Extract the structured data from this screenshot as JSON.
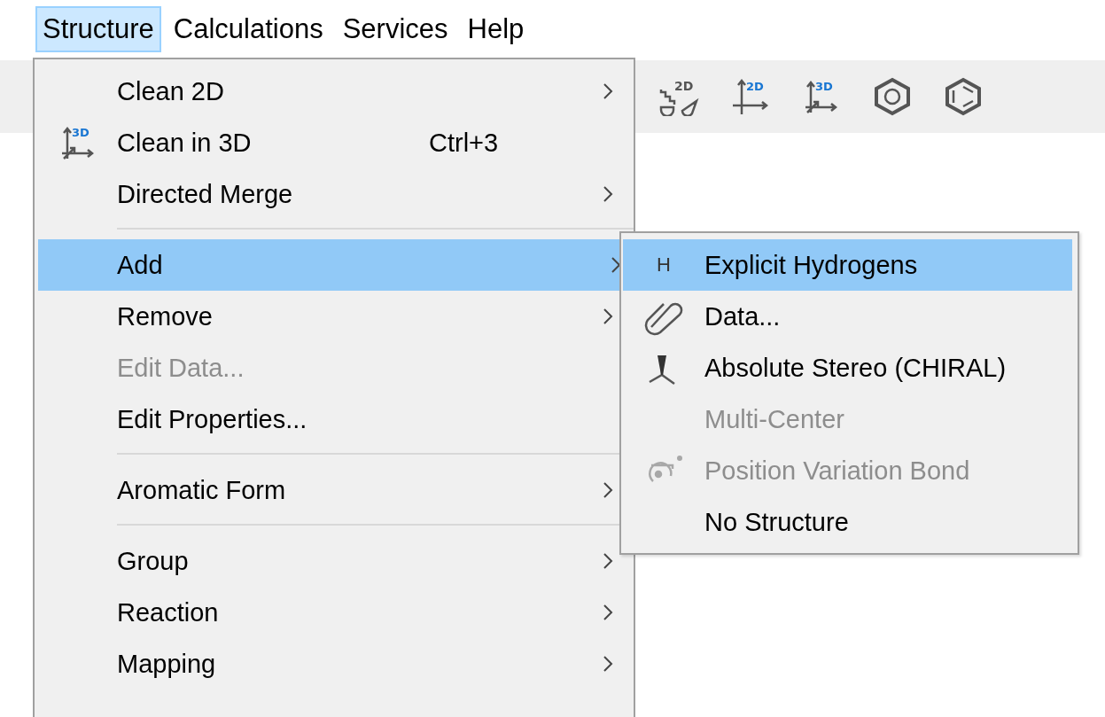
{
  "menubar": [
    {
      "label": "Structure",
      "selected": true
    },
    {
      "label": "Calculations",
      "selected": false
    },
    {
      "label": "Services",
      "selected": false
    },
    {
      "label": "Help",
      "selected": false
    }
  ],
  "toolbar": [
    {
      "kind": "sketch-clean",
      "badge": "2D"
    },
    {
      "kind": "axes-2d",
      "badge": "2D"
    },
    {
      "kind": "axes-3d",
      "badge": "3D"
    },
    {
      "kind": "ring-circle"
    },
    {
      "kind": "ring-lines"
    }
  ],
  "menu": {
    "items": [
      {
        "kind": "plain",
        "label": "Clean 2D",
        "submenu": true,
        "disabled": false,
        "selected": false
      },
      {
        "kind": "axes3d",
        "icon_text": "3D",
        "label": "Clean in 3D",
        "shortcut": "Ctrl+3",
        "submenu": false,
        "disabled": false,
        "selected": false
      },
      {
        "kind": "plain",
        "label": "Directed Merge",
        "submenu": true,
        "disabled": false,
        "selected": false
      },
      {
        "kind": "separator"
      },
      {
        "kind": "plain",
        "label": "Add",
        "submenu": true,
        "disabled": false,
        "selected": true
      },
      {
        "kind": "plain",
        "label": "Remove",
        "submenu": true,
        "disabled": false,
        "selected": false
      },
      {
        "kind": "plain",
        "label": "Edit Data...",
        "submenu": false,
        "disabled": true,
        "selected": false
      },
      {
        "kind": "plain",
        "label": "Edit Properties...",
        "submenu": false,
        "disabled": false,
        "selected": false
      },
      {
        "kind": "separator"
      },
      {
        "kind": "plain",
        "label": "Aromatic Form",
        "submenu": true,
        "disabled": false,
        "selected": false
      },
      {
        "kind": "separator"
      },
      {
        "kind": "plain",
        "label": "Group",
        "submenu": true,
        "disabled": false,
        "selected": false
      },
      {
        "kind": "plain",
        "label": "Reaction",
        "submenu": true,
        "disabled": false,
        "selected": false
      },
      {
        "kind": "plain",
        "label": "Mapping",
        "submenu": true,
        "disabled": false,
        "selected": false
      }
    ]
  },
  "submenu": {
    "items": [
      {
        "kind": "letter",
        "icon_text": "H",
        "label": "Explicit Hydrogens",
        "disabled": false,
        "selected": true
      },
      {
        "kind": "paperclip",
        "label": "Data...",
        "disabled": false,
        "selected": false
      },
      {
        "kind": "stereo",
        "label": "Absolute Stereo (CHIRAL)",
        "disabled": false,
        "selected": false
      },
      {
        "kind": "plain",
        "label": "Multi-Center",
        "disabled": true,
        "selected": false
      },
      {
        "kind": "positionbond",
        "label": "Position Variation Bond",
        "disabled": true,
        "selected": false
      },
      {
        "kind": "plain",
        "label": "No Structure",
        "disabled": false,
        "selected": false
      }
    ]
  }
}
